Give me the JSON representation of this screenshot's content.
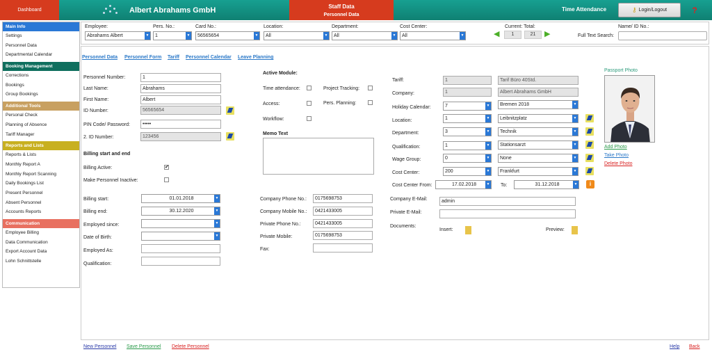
{
  "header": {
    "dashboard": "Dashboard",
    "company": "Albert Abrahams GmbH",
    "staff_title": "Staff Data",
    "staff_sub": "Personnel Data",
    "time_attendance": "Time Attendance",
    "login": "Login/Logout",
    "help": "?"
  },
  "sidebar": {
    "sections": [
      {
        "title": "Main Info",
        "color": "#2a78d6",
        "items": [
          "Settings",
          "Personnel Data",
          "Departmental Calendar"
        ]
      },
      {
        "title": "Booking Management",
        "color": "#0f6f5e",
        "items": [
          "Corrections",
          "Bookings",
          "Group Bookings"
        ]
      },
      {
        "title": "Additional Tools",
        "color": "#c8a060",
        "items": [
          "Personal Check",
          "Planning of Absence",
          "Tariff Manager"
        ]
      },
      {
        "title": "Reports and Lists",
        "color": "#c8b020",
        "items": [
          "Reports & Lists",
          "Monthly Report A",
          "Monthly Report Scanning",
          "Daily Bookings List",
          "Present Personnel",
          "Absent Personnel",
          "Accounts Reports"
        ]
      },
      {
        "title": "Communication",
        "color": "#e87060",
        "items": [
          "Employee Billing",
          "Data Communication",
          "Export Account Data",
          "Lohn Schnittstelle"
        ]
      }
    ]
  },
  "filter": {
    "employee_label": "Employee:",
    "employee": "Abrahams Albert",
    "persno_label": "Pers. No.:",
    "persno": "1",
    "cardno_label": "Card No.:",
    "cardno": "56565654",
    "location_label": "Location:",
    "location": "All",
    "department_label": "Department:",
    "department": "All",
    "costcenter_label": "Cost Center:",
    "costcenter": "All",
    "current_total_label": "Current: Total:",
    "current": "1",
    "total": "21",
    "nameid_label": "Name/ ID No.:",
    "fulltext_label": "Full Text Search:",
    "fulltext": ""
  },
  "tabs": [
    "Personnel Data",
    "Personnel Form",
    "Tariff",
    "Personnel Calendar",
    "Leave Planning"
  ],
  "personal": {
    "persnum_label": "Personnel Number:",
    "persnum": "1",
    "lastname_label": "Last Name:",
    "lastname": "Abrahams",
    "firstname_label": "First Name:",
    "firstname": "Albert",
    "idnum_label": "ID Number:",
    "idnum": "56565654",
    "pin_label": "PIN Code/ Password:",
    "pin": "•••••",
    "id2_label": "2. ID Number:",
    "id2": "123456",
    "billing_heading": "Billing start and end",
    "billing_active": "Billing Active:",
    "inactive": "Make Personnel Inactive:",
    "billing_start_label": "Billing start:",
    "billing_start": "01.01.2018",
    "billing_end_label": "Billing end:",
    "billing_end": "30.12.2020",
    "employed_since_label": "Employed since:",
    "employed_since": "",
    "dob_label": "Date of Birth:",
    "dob": "",
    "employed_as_label": "Employed As:",
    "employed_as": "",
    "qualification_label": "Qualification:",
    "qualification": ""
  },
  "modules": {
    "heading": "Active Module:",
    "time_attendance": "Time attendance:",
    "project_tracking": "Project Tracking:",
    "access": "Access:",
    "pers_planning": "Pers. Planning:",
    "workflow": "Workflow:",
    "memo_label": "Memo Text"
  },
  "contact": {
    "company_phone_label": "Company Phone No.:",
    "company_phone": "0175698753",
    "company_mobile_label": "Company Mobile No.:",
    "company_mobile": "0421433005",
    "private_phone_label": "Private Phone No.:",
    "private_phone": "0421433005",
    "private_mobile_label": "Private Mobile:",
    "private_mobile": "0175698753",
    "fax_label": "Fax:",
    "fax": ""
  },
  "assignment": {
    "tariff_label": "Tariff:",
    "tariff_id": "1",
    "tariff_name": "Tarif Büro 40Std.",
    "company_label": "Company:",
    "company_id": "1",
    "company_name": "Albert Abrahams GmbH",
    "holiday_label": "Holiday Calendar:",
    "holiday_id": "7",
    "holiday_name": "Bremen 2018",
    "location_label": "Location:",
    "location_id": "1",
    "location_name": "Leibnitzplatz",
    "department_label": "Department:",
    "department_id": "3",
    "department_name": "Technik",
    "qualification_label": "Qualification:",
    "qualification_id": "1",
    "qualification_name": "Stationsarzt",
    "wage_label": "Wage Group:",
    "wage_id": "0",
    "wage_name": "None",
    "costcenter_label": "Cost Center:",
    "costcenter_id": "200",
    "costcenter_name": "Frankfurt",
    "cc_from_label": "Cost Center From:",
    "cc_from": "17.02.2018",
    "cc_to_label": "To:",
    "cc_to": "31.12.2018",
    "company_email_label": "Company E-Mail:",
    "company_email": "admin",
    "private_email_label": "Private E-Mail:",
    "private_email": "",
    "documents_label": "Documents:",
    "insert_label": "Insert:",
    "preview_label": "Preview:"
  },
  "photo": {
    "label": "Passport Photo",
    "add": "Add Photo",
    "take": "Take Photo",
    "delete": "Delete Photo"
  },
  "footer": {
    "new": "New Personnel",
    "save": "Save Personnel",
    "delete": "Delete Personnel",
    "help": "Help",
    "back": "Back"
  }
}
